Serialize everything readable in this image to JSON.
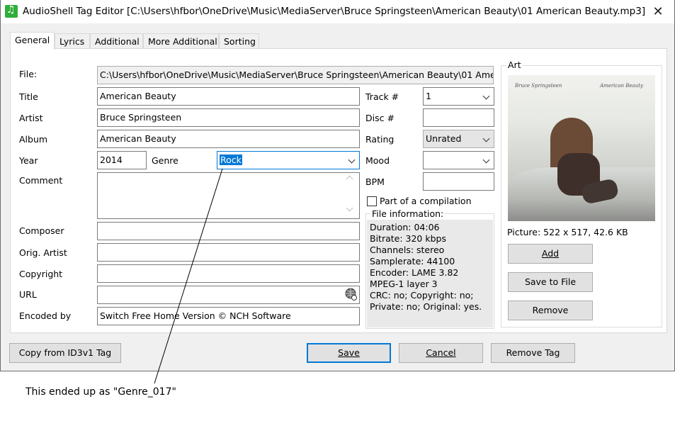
{
  "window": {
    "title": "AudioShell Tag Editor [C:\\Users\\hfbor\\OneDrive\\Music\\MediaServer\\Bruce Springsteen\\American Beauty\\01 American Beauty.mp3]",
    "close_glyph": "✕"
  },
  "tabs": [
    "General",
    "Lyrics",
    "Additional",
    "More Additional",
    "Sorting"
  ],
  "fields": {
    "file_label": "File:",
    "file_value": "C:\\Users\\hfbor\\OneDrive\\Music\\MediaServer\\Bruce Springsteen\\American Beauty\\01 American Beauty.mp3",
    "title_label": "Title",
    "title_value": "American Beauty",
    "artist_label": "Artist",
    "artist_value": "Bruce Springsteen",
    "album_label": "Album",
    "album_value": "American Beauty",
    "year_label": "Year",
    "year_value": "2014",
    "genre_label": "Genre",
    "genre_value": "Rock",
    "comment_label": "Comment",
    "comment_value": "",
    "composer_label": "Composer",
    "composer_value": "",
    "orig_artist_label": "Orig. Artist",
    "orig_artist_value": "",
    "copyright_label": "Copyright",
    "copyright_value": "",
    "url_label": "URL",
    "url_value": "",
    "encoded_by_label": "Encoded by",
    "encoded_by_value": "Switch Free Home Version © NCH Software",
    "track_label": "Track #",
    "track_value": "1",
    "disc_label": "Disc #",
    "disc_value": "",
    "rating_label": "Rating",
    "rating_value": "Unrated",
    "mood_label": "Mood",
    "mood_value": "",
    "bpm_label": "BPM",
    "bpm_value": "",
    "compilation_label": "Part of a compilation",
    "compilation_checked": false
  },
  "file_info": {
    "title": "File information:",
    "lines": [
      "Duration: 04:06",
      "Bitrate: 320 kbps",
      "Channels: stereo",
      "Samplerate: 44100",
      "Encoder: LAME 3.82",
      "MPEG-1 layer 3",
      "CRC: no; Copyright: no;",
      "Private: no; Original: yes."
    ]
  },
  "art": {
    "title": "Art",
    "cover_artist_text": "Bruce Springsteen",
    "cover_album_text": "American Beauty",
    "picture_info": "Picture: 522 x 517, 42.6 KB",
    "add_label": "Add",
    "save_to_file_label": "Save to File",
    "remove_label": "Remove"
  },
  "buttons": {
    "copy_from_id3v1": "Copy from ID3v1 Tag",
    "save": "Save",
    "cancel": "Cancel",
    "remove_tag": "Remove Tag"
  },
  "annotation": "This ended up as \"Genre_017\"",
  "colors": {
    "selection": "#0078d7",
    "focus_border": "#0078d7",
    "app_icon": "#2fae3a"
  }
}
